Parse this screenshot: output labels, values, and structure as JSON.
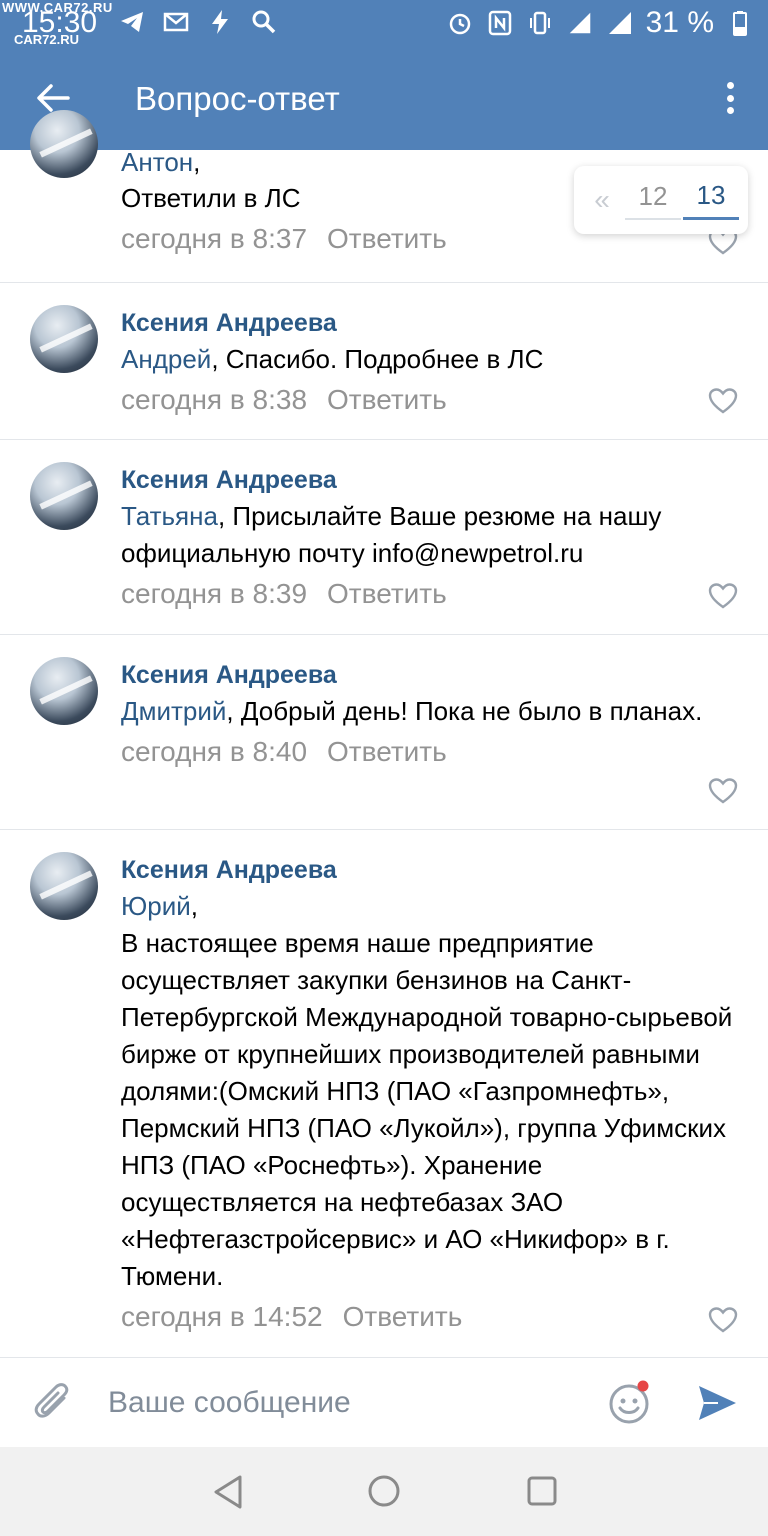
{
  "status_bar": {
    "time": "15:30",
    "watermark_top": "WWW.CAR72.RU",
    "watermark_bottom": "CAR72.RU",
    "network": "4G",
    "battery": "31 %"
  },
  "header": {
    "title": "Вопрос-ответ"
  },
  "pager": {
    "prev": "«",
    "pages": [
      "12",
      "13"
    ],
    "active": "13"
  },
  "comments": [
    {
      "author": "Антон",
      "mention": "",
      "text_after_author": ",",
      "text": "Ответили в ЛС",
      "time": "сегодня в 8:37",
      "reply": "Ответить"
    },
    {
      "author": "Ксения Андреева",
      "mention": "Андрей",
      "text": ", Спасибо. Подробнее в ЛС",
      "time": "сегодня в 8:38",
      "reply": "Ответить"
    },
    {
      "author": "Ксения Андреева",
      "mention": "Татьяна",
      "text": ", Присылайте Ваше резюме на нашу официальную почту info@newpetrol.ru",
      "time": "сегодня в 8:39",
      "reply": "Ответить"
    },
    {
      "author": "Ксения Андреева",
      "mention": "Дмитрий",
      "text": ", Добрый день! Пока не было в планах.",
      "time": "сегодня в 8:40",
      "reply": "Ответить"
    },
    {
      "author": "Ксения Андреева",
      "mention": "Юрий",
      "text": ",",
      "text2": "В настоящее время наше предприятие осуществляет закупки бензинов на Санкт-Петербургской Международной товарно-сырьевой бирже от крупнейших производителей равными долями:(Омский НПЗ (ПАО «Газпромнефть», Пермский НПЗ (ПАО «Лукойл»), группа Уфимских НПЗ (ПАО «Роснефть»). Хранение осуществляется на нефтебазах ЗАО «Нефтегазстройсервис» и АО «Никифор» в г. Тюмени.",
      "time": "сегодня в 14:52",
      "reply": "Ответить"
    }
  ],
  "composer": {
    "placeholder": "Ваше сообщение"
  },
  "colors": {
    "header_bg": "#5181b8",
    "link": "#2a5885",
    "meta": "#939393"
  }
}
